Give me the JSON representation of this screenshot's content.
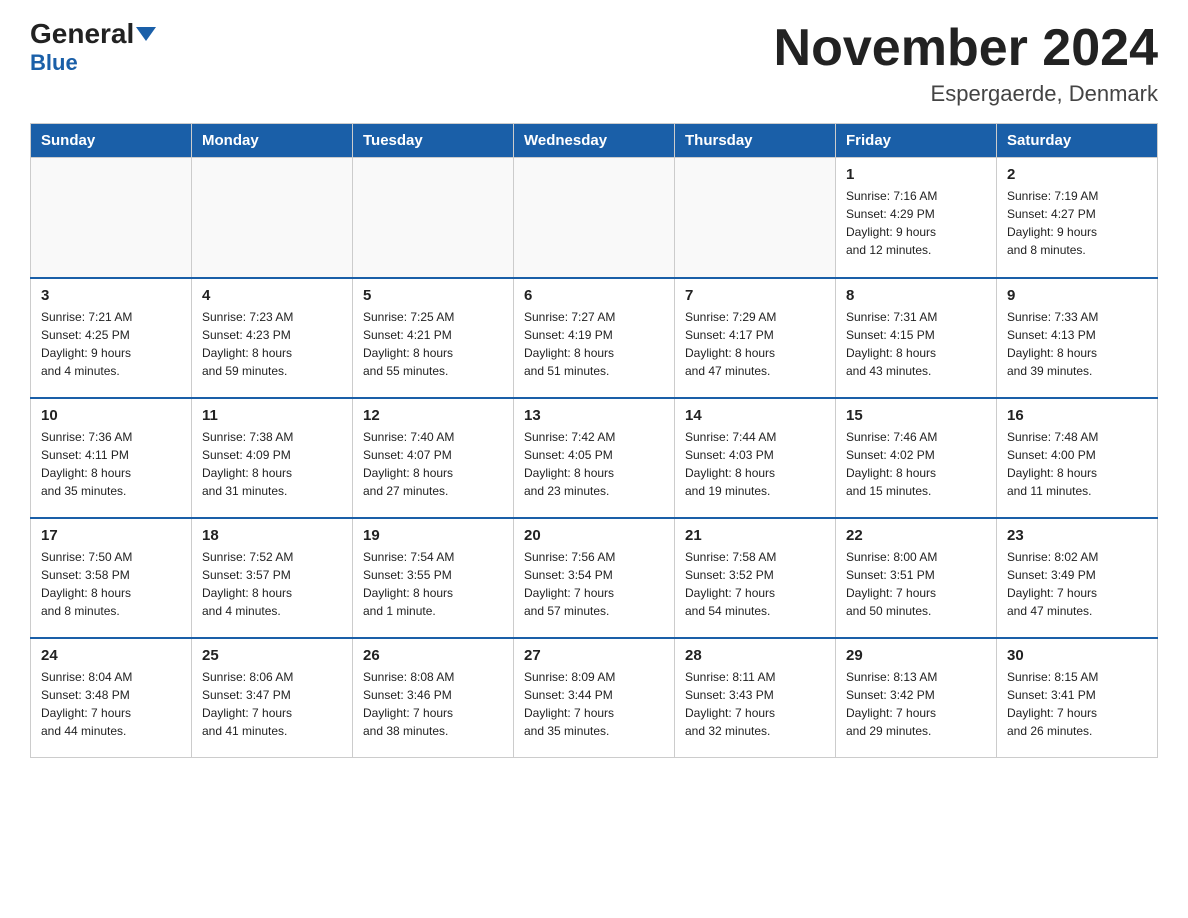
{
  "header": {
    "logo_text1": "General",
    "logo_text2": "Blue",
    "month_title": "November 2024",
    "location": "Espergaerde, Denmark"
  },
  "days_of_week": [
    "Sunday",
    "Monday",
    "Tuesday",
    "Wednesday",
    "Thursday",
    "Friday",
    "Saturday"
  ],
  "weeks": [
    [
      {
        "day": "",
        "info": ""
      },
      {
        "day": "",
        "info": ""
      },
      {
        "day": "",
        "info": ""
      },
      {
        "day": "",
        "info": ""
      },
      {
        "day": "",
        "info": ""
      },
      {
        "day": "1",
        "info": "Sunrise: 7:16 AM\nSunset: 4:29 PM\nDaylight: 9 hours\nand 12 minutes."
      },
      {
        "day": "2",
        "info": "Sunrise: 7:19 AM\nSunset: 4:27 PM\nDaylight: 9 hours\nand 8 minutes."
      }
    ],
    [
      {
        "day": "3",
        "info": "Sunrise: 7:21 AM\nSunset: 4:25 PM\nDaylight: 9 hours\nand 4 minutes."
      },
      {
        "day": "4",
        "info": "Sunrise: 7:23 AM\nSunset: 4:23 PM\nDaylight: 8 hours\nand 59 minutes."
      },
      {
        "day": "5",
        "info": "Sunrise: 7:25 AM\nSunset: 4:21 PM\nDaylight: 8 hours\nand 55 minutes."
      },
      {
        "day": "6",
        "info": "Sunrise: 7:27 AM\nSunset: 4:19 PM\nDaylight: 8 hours\nand 51 minutes."
      },
      {
        "day": "7",
        "info": "Sunrise: 7:29 AM\nSunset: 4:17 PM\nDaylight: 8 hours\nand 47 minutes."
      },
      {
        "day": "8",
        "info": "Sunrise: 7:31 AM\nSunset: 4:15 PM\nDaylight: 8 hours\nand 43 minutes."
      },
      {
        "day": "9",
        "info": "Sunrise: 7:33 AM\nSunset: 4:13 PM\nDaylight: 8 hours\nand 39 minutes."
      }
    ],
    [
      {
        "day": "10",
        "info": "Sunrise: 7:36 AM\nSunset: 4:11 PM\nDaylight: 8 hours\nand 35 minutes."
      },
      {
        "day": "11",
        "info": "Sunrise: 7:38 AM\nSunset: 4:09 PM\nDaylight: 8 hours\nand 31 minutes."
      },
      {
        "day": "12",
        "info": "Sunrise: 7:40 AM\nSunset: 4:07 PM\nDaylight: 8 hours\nand 27 minutes."
      },
      {
        "day": "13",
        "info": "Sunrise: 7:42 AM\nSunset: 4:05 PM\nDaylight: 8 hours\nand 23 minutes."
      },
      {
        "day": "14",
        "info": "Sunrise: 7:44 AM\nSunset: 4:03 PM\nDaylight: 8 hours\nand 19 minutes."
      },
      {
        "day": "15",
        "info": "Sunrise: 7:46 AM\nSunset: 4:02 PM\nDaylight: 8 hours\nand 15 minutes."
      },
      {
        "day": "16",
        "info": "Sunrise: 7:48 AM\nSunset: 4:00 PM\nDaylight: 8 hours\nand 11 minutes."
      }
    ],
    [
      {
        "day": "17",
        "info": "Sunrise: 7:50 AM\nSunset: 3:58 PM\nDaylight: 8 hours\nand 8 minutes."
      },
      {
        "day": "18",
        "info": "Sunrise: 7:52 AM\nSunset: 3:57 PM\nDaylight: 8 hours\nand 4 minutes."
      },
      {
        "day": "19",
        "info": "Sunrise: 7:54 AM\nSunset: 3:55 PM\nDaylight: 8 hours\nand 1 minute."
      },
      {
        "day": "20",
        "info": "Sunrise: 7:56 AM\nSunset: 3:54 PM\nDaylight: 7 hours\nand 57 minutes."
      },
      {
        "day": "21",
        "info": "Sunrise: 7:58 AM\nSunset: 3:52 PM\nDaylight: 7 hours\nand 54 minutes."
      },
      {
        "day": "22",
        "info": "Sunrise: 8:00 AM\nSunset: 3:51 PM\nDaylight: 7 hours\nand 50 minutes."
      },
      {
        "day": "23",
        "info": "Sunrise: 8:02 AM\nSunset: 3:49 PM\nDaylight: 7 hours\nand 47 minutes."
      }
    ],
    [
      {
        "day": "24",
        "info": "Sunrise: 8:04 AM\nSunset: 3:48 PM\nDaylight: 7 hours\nand 44 minutes."
      },
      {
        "day": "25",
        "info": "Sunrise: 8:06 AM\nSunset: 3:47 PM\nDaylight: 7 hours\nand 41 minutes."
      },
      {
        "day": "26",
        "info": "Sunrise: 8:08 AM\nSunset: 3:46 PM\nDaylight: 7 hours\nand 38 minutes."
      },
      {
        "day": "27",
        "info": "Sunrise: 8:09 AM\nSunset: 3:44 PM\nDaylight: 7 hours\nand 35 minutes."
      },
      {
        "day": "28",
        "info": "Sunrise: 8:11 AM\nSunset: 3:43 PM\nDaylight: 7 hours\nand 32 minutes."
      },
      {
        "day": "29",
        "info": "Sunrise: 8:13 AM\nSunset: 3:42 PM\nDaylight: 7 hours\nand 29 minutes."
      },
      {
        "day": "30",
        "info": "Sunrise: 8:15 AM\nSunset: 3:41 PM\nDaylight: 7 hours\nand 26 minutes."
      }
    ]
  ]
}
